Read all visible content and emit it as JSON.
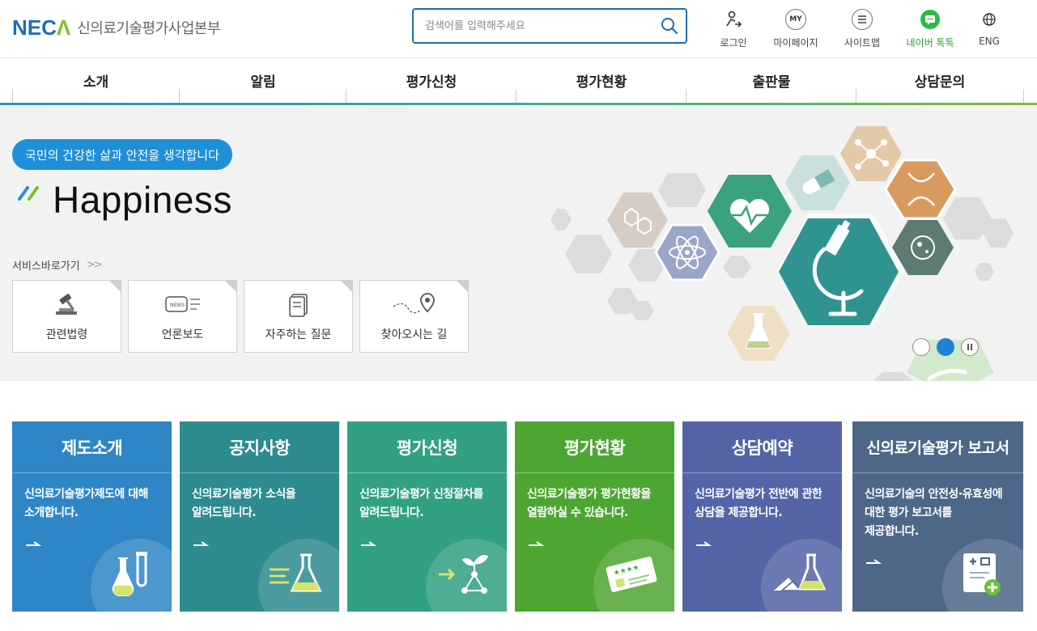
{
  "header": {
    "logo_mark_main": "NEC",
    "logo_mark_accent": "Λ",
    "logo_text": "신의료기술평가사업본부",
    "search_placeholder": "검색어를 입력해주세요",
    "utils": [
      {
        "label": "로그인",
        "icon": "login-icon"
      },
      {
        "label": "마이페이지",
        "icon": "my-icon",
        "icon_text": "MY"
      },
      {
        "label": "사이트맵",
        "icon": "sitemap-icon"
      },
      {
        "label": "네이버 톡톡",
        "icon": "naver-talk-icon"
      },
      {
        "label": "ENG",
        "icon": "globe-icon"
      }
    ]
  },
  "nav": {
    "items": [
      "소개",
      "알림",
      "평가신청",
      "평가현황",
      "출판물",
      "상담문의"
    ]
  },
  "visual": {
    "slogan": "국민의 건강한 삶과 안전을 생각합니다",
    "headline": "Happiness",
    "quick_title": "서비스바로가기",
    "quick_chevron": ">>",
    "quick_links": [
      {
        "label": "관련법령",
        "icon": "gavel-icon"
      },
      {
        "label": "언론보도",
        "icon": "news-icon"
      },
      {
        "label": "자주하는 질문",
        "icon": "notebook-icon"
      },
      {
        "label": "찾아오시는 길",
        "icon": "location-pin-icon"
      }
    ],
    "slider": {
      "count": 2,
      "current": 2
    }
  },
  "cards": [
    {
      "title": "제도소개",
      "desc": [
        "신의료기술평가제도에 대해",
        "소개합니다."
      ],
      "color": "#2f86c6",
      "icon": "test-tube-icon"
    },
    {
      "title": "공지사항",
      "desc": [
        "신의료기술평가 소식을",
        "알려드립니다."
      ],
      "color": "#2e8b8f",
      "icon": "flask-list-icon"
    },
    {
      "title": "평가신청",
      "desc": [
        "신의료기술평가 신청절차를",
        "알려드립니다."
      ],
      "color": "#32a082",
      "icon": "sprout-icon"
    },
    {
      "title": "평가현황",
      "desc": [
        "신의료기술평가 평가현황을",
        "열람하실 수 있습니다."
      ],
      "color": "#4ea632",
      "icon": "rating-card-icon"
    },
    {
      "title": "상담예약",
      "desc": [
        "신의료기술평가 전반에 관한",
        "상담을 제공합니다."
      ],
      "color": "#5564a6",
      "icon": "consult-icon"
    },
    {
      "title": "신의료기술평가 보고서",
      "desc": [
        "신의료기술의 안전성·유효성에",
        "대한 평가 보고서를",
        "제공합니다."
      ],
      "color": "#4d6789",
      "icon": "report-icon"
    }
  ]
}
